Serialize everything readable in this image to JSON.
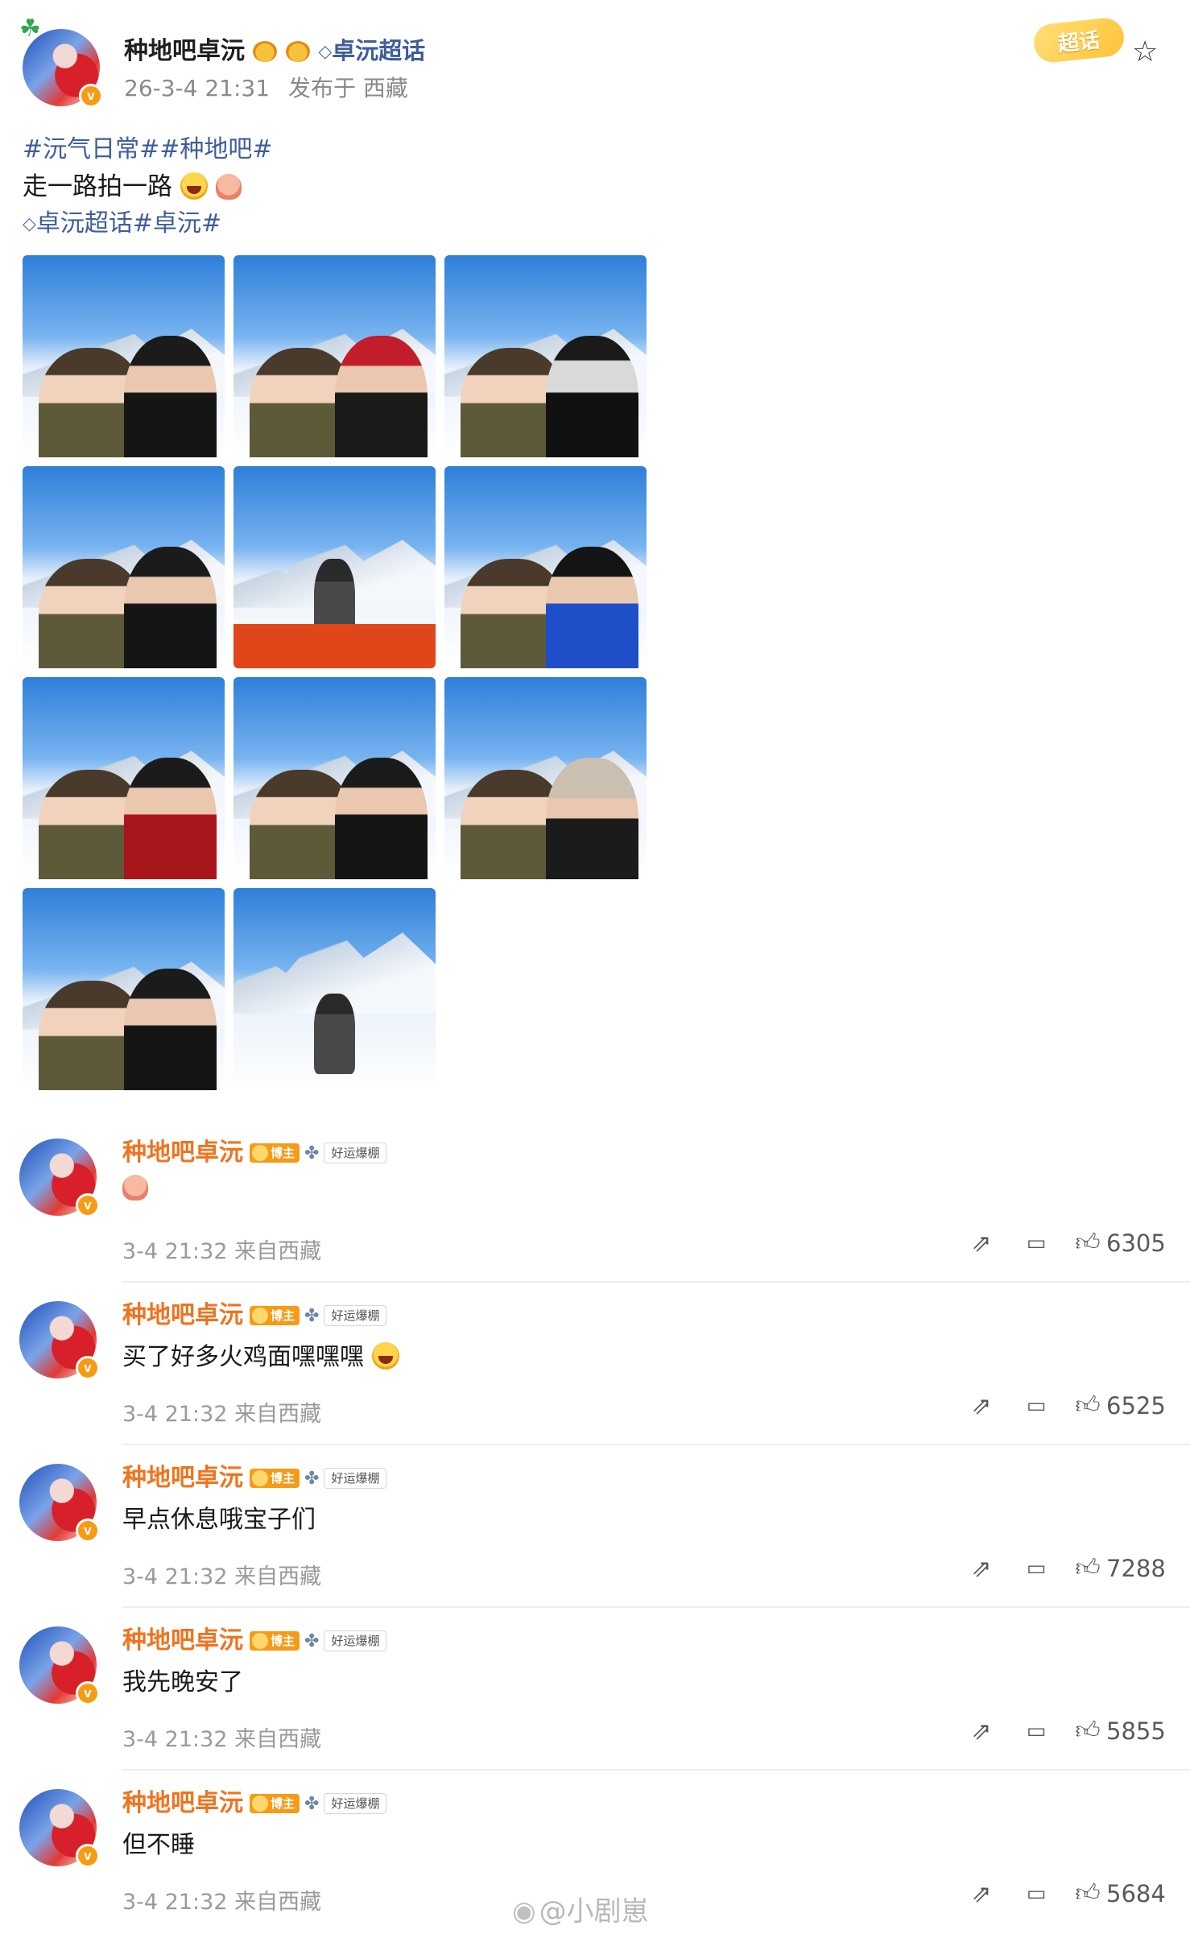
{
  "post": {
    "author": "种地吧卓沅",
    "super_topic_link": "卓沅超话",
    "time": "26-3-4 21:31",
    "location": "发布于 西藏",
    "hashtags": "#沅气日常##种地吧#",
    "text": "走一路拍一路",
    "topic_line": "卓沅超话#卓沅#",
    "super_chip": "超话",
    "icons": [
      "clover-icon",
      "star-icon",
      "diamond-icon",
      "v-badge-icon"
    ]
  },
  "photos": [
    {
      "scene": "duo-selfie",
      "second_person": "black jacket"
    },
    {
      "scene": "duo-selfie",
      "second_person": "red cap"
    },
    {
      "scene": "duo-selfie",
      "second_person": "mask"
    },
    {
      "scene": "duo-selfie",
      "second_person": "sunglasses"
    },
    {
      "scene": "solo-on-vehicle",
      "second_person": ""
    },
    {
      "scene": "duo-selfie",
      "second_person": "blue jacket"
    },
    {
      "scene": "duo-selfie",
      "second_person": "red jacket"
    },
    {
      "scene": "duo-selfie",
      "second_person": "sunglasses"
    },
    {
      "scene": "duo-selfie",
      "second_person": "fur hood"
    },
    {
      "scene": "duo-selfie",
      "second_person": "black beanie"
    },
    {
      "scene": "solo-snowfield",
      "second_person": ""
    }
  ],
  "comment_badges": {
    "blogger": "博主",
    "luck": "好运爆棚"
  },
  "comments": [
    {
      "name": "种地吧卓沅",
      "text": "",
      "time": "3-4 21:32",
      "location": "来自西藏",
      "likes": "6305"
    },
    {
      "name": "种地吧卓沅",
      "text": "买了好多火鸡面嘿嘿嘿",
      "time": "3-4 21:32",
      "location": "来自西藏",
      "likes": "6525"
    },
    {
      "name": "种地吧卓沅",
      "text": "早点休息哦宝子们",
      "time": "3-4 21:32",
      "location": "来自西藏",
      "likes": "7288"
    },
    {
      "name": "种地吧卓沅",
      "text": "我先晚安了",
      "time": "3-4 21:32",
      "location": "来自西藏",
      "likes": "5855"
    },
    {
      "name": "种地吧卓沅",
      "text": "但不睡",
      "time": "3-4 21:32",
      "location": "来自西藏",
      "likes": "5684"
    }
  ],
  "watermark": "@小剧崽",
  "colors": {
    "link": "#3f5e9a",
    "author_orange": "#f0731e",
    "badge_orange": "#f79b13",
    "meta_gray": "#9a9a9a"
  }
}
